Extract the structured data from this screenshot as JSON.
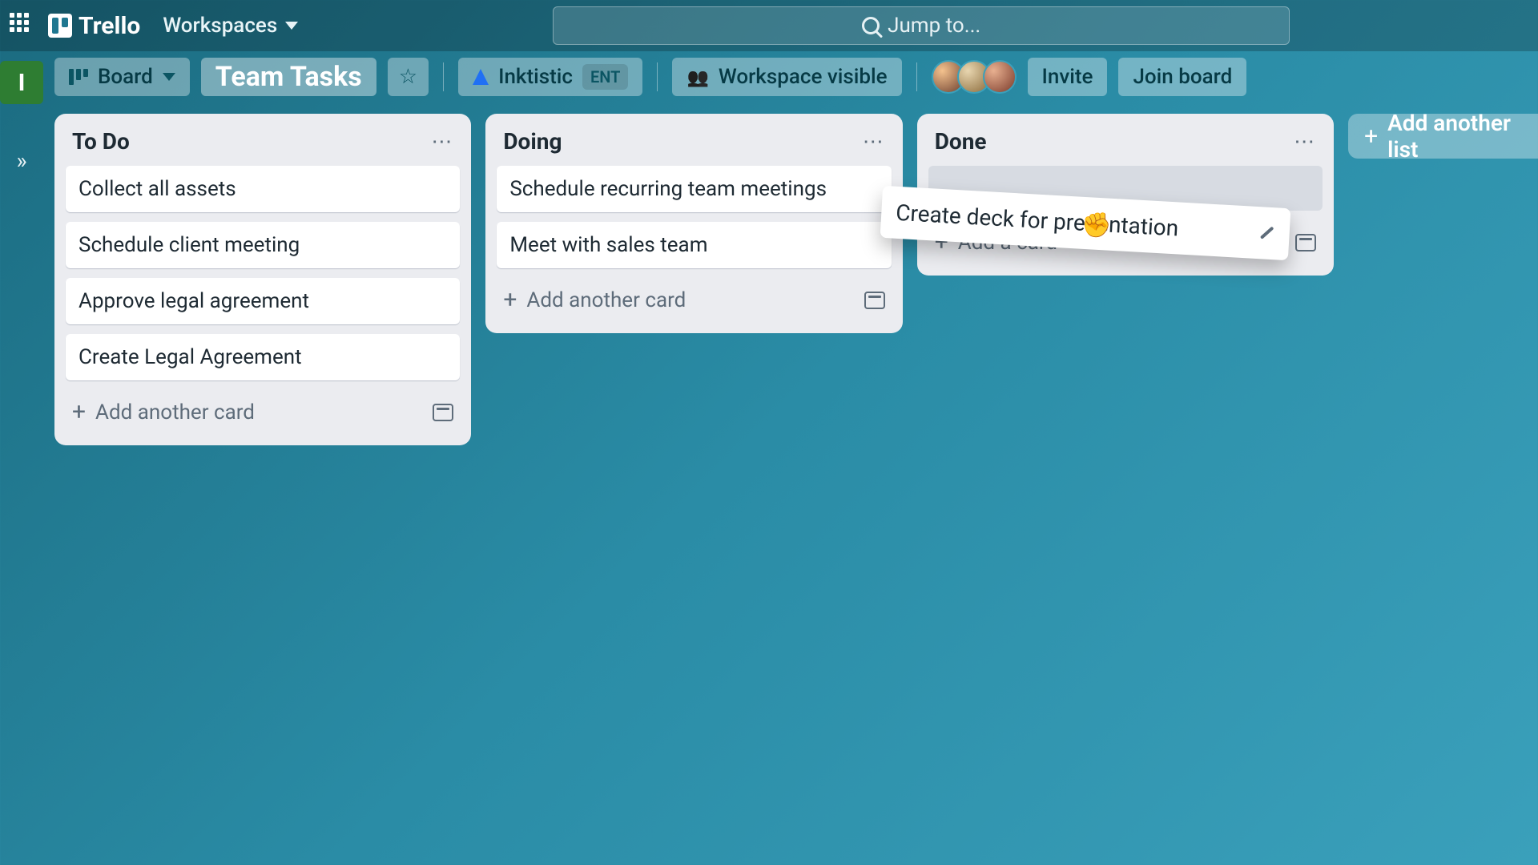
{
  "header": {
    "logo_text": "Trello",
    "workspaces_label": "Workspaces",
    "search_placeholder": "Jump to..."
  },
  "toolbar": {
    "board_view_label": "Board",
    "board_title": "Team Tasks",
    "workspace_name": "Inktistic",
    "workspace_badge": "ENT",
    "visibility_label": "Workspace visible",
    "invite_label": "Invite",
    "join_label": "Join board",
    "ws_initial": "I"
  },
  "lists": [
    {
      "title": "To Do",
      "cards": [
        "Collect all assets",
        "Schedule client meeting",
        "Approve legal agreement",
        "Create Legal Agreement"
      ],
      "add_label": "Add another card"
    },
    {
      "title": "Doing",
      "cards": [
        "Schedule recurring team meetings",
        "Meet with sales team"
      ],
      "add_label": "Add another card"
    },
    {
      "title": "Done",
      "cards": [],
      "add_label": "Add a card"
    }
  ],
  "dragging_card": {
    "title": "Create deck for presentation"
  },
  "add_list_label": "Add another list"
}
